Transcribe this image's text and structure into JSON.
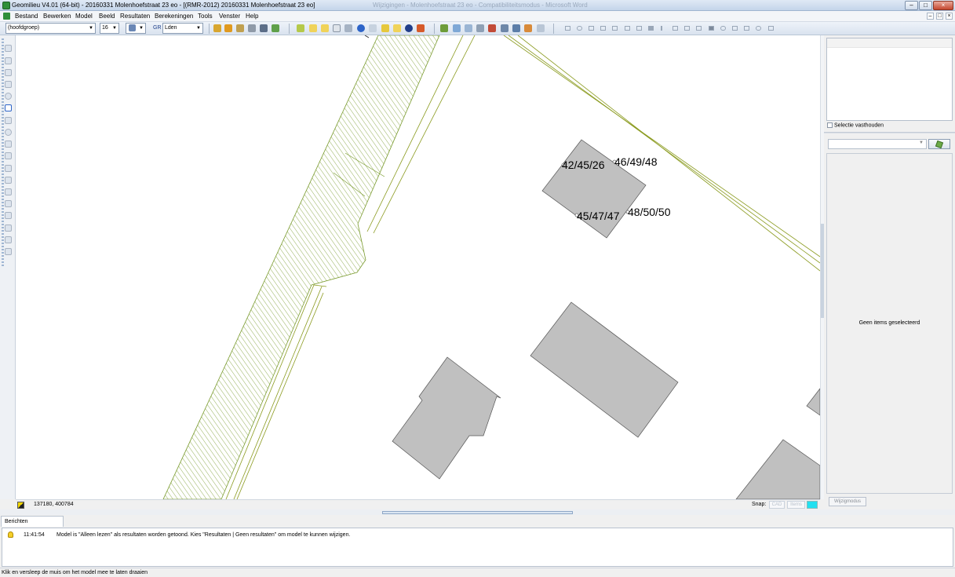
{
  "window": {
    "title": "Geomilieu V4.01 (64-bit) - 20160331 Molenhoefstraat 23 eo - [(RMR-2012) 20160331 Molenhoefstraat 23 eo]",
    "ghost_title": "Wijzigingen - Molenhoefstraat 23 eo - Compatibiliteitsmodus - Microsoft Word",
    "minimize": "–",
    "maximize": "□",
    "close": "×"
  },
  "menu": {
    "items": [
      "Bestand",
      "Bewerken",
      "Model",
      "Beeld",
      "Resultaten",
      "Berekeningen",
      "Tools",
      "Venster",
      "Help"
    ]
  },
  "toolbar": {
    "group_select": "(hoofdgroep)",
    "font_size": "16",
    "gr_label": "GR",
    "metric_select": "Lden"
  },
  "map": {
    "labels": {
      "b1": "42/45/26",
      "b2": "46/49/48",
      "b3": "45/47/47",
      "b4": "48/50/50"
    },
    "colors": {
      "building_fill": "#c0c0c0",
      "road_line": "#8a9a1e",
      "hatch": "#7a9b2e"
    }
  },
  "map_status": {
    "coords": "137180, 400784",
    "snap_label": "Snap:",
    "snap_cad": "CAD",
    "snap_items": "Items"
  },
  "right_panel": {
    "keep_selection_label": "Selectie vasthouden",
    "empty_text": "Geen items geselecteerd",
    "edit_mode_button": "Wijzigmodus"
  },
  "messages": {
    "tab_label": "Berichten",
    "rows": [
      {
        "time": "11:41:54",
        "text": "Model is \"Alleen lezen\" als resultaten worden getoond. Kies \"Resultaten | Geen resultaten\" om model te kunnen wijzigen."
      }
    ]
  },
  "statusbar": {
    "text": "Klik en versleep de muis om het model mee te laten draaien"
  }
}
